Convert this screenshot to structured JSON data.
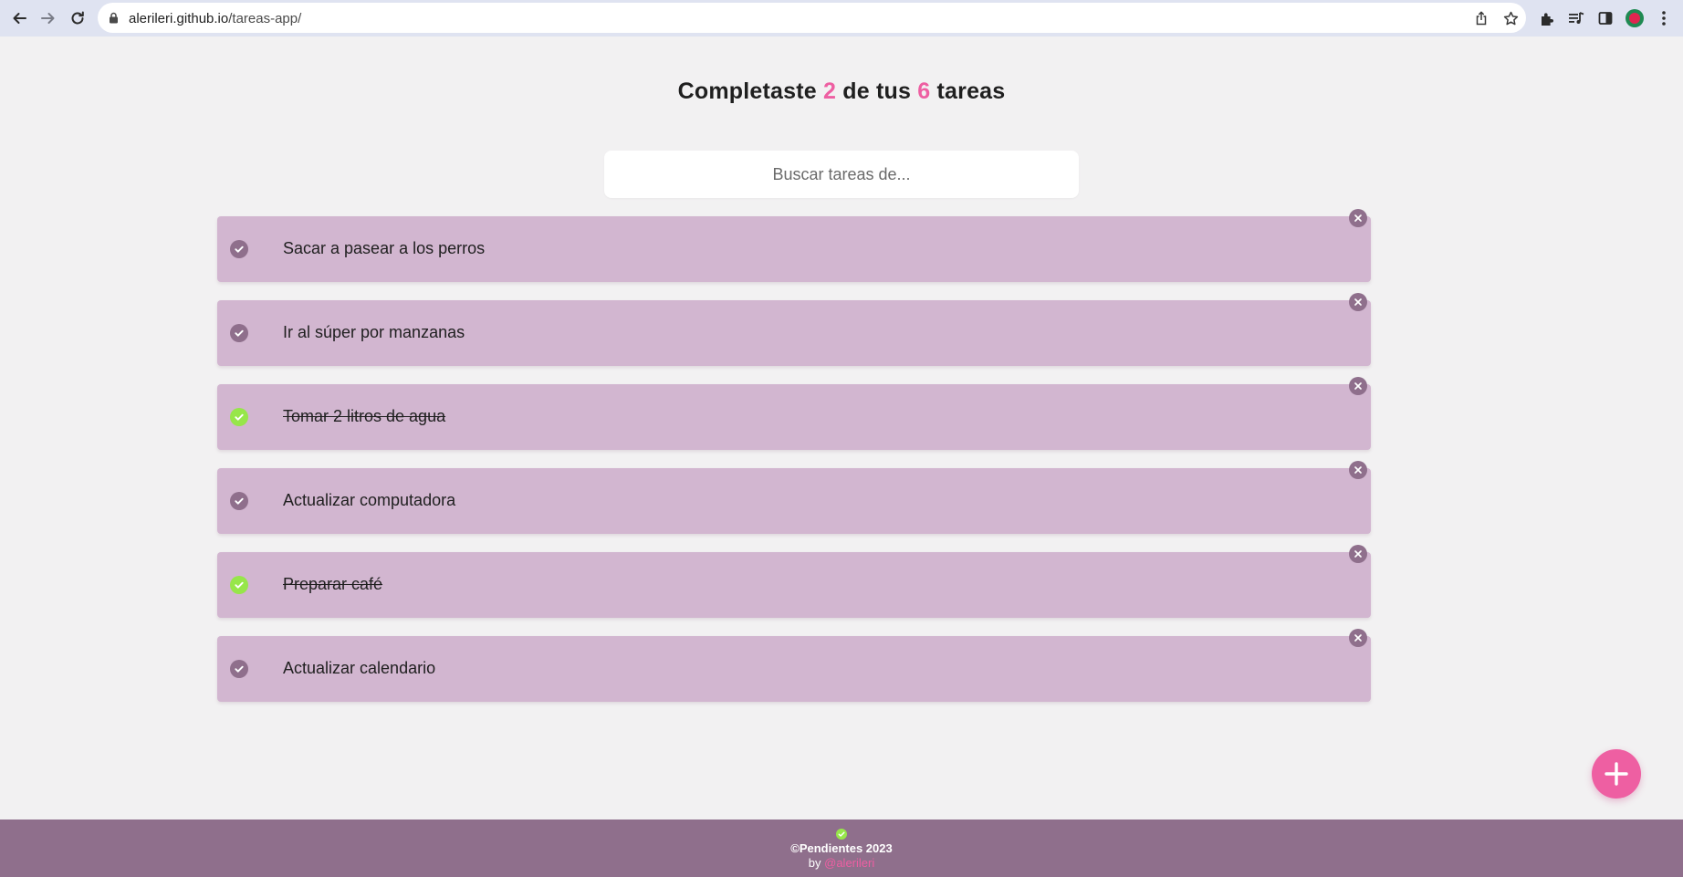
{
  "browser": {
    "url_host": "alerileri.github.io",
    "url_path": "/tareas-app/"
  },
  "header": {
    "title_part1": "Completaste",
    "completed_count": "2",
    "title_part2": "de tus",
    "total_count": "6",
    "title_part3": "tareas"
  },
  "search": {
    "placeholder": "Buscar tareas de...",
    "value": ""
  },
  "todos": [
    {
      "text": "Sacar a pasear a los perros",
      "completed": false
    },
    {
      "text": "Ir al súper por manzanas",
      "completed": false
    },
    {
      "text": "Tomar 2 litros de agua",
      "completed": true
    },
    {
      "text": "Actualizar computadora",
      "completed": false
    },
    {
      "text": "Preparar café",
      "completed": true
    },
    {
      "text": "Actualizar calendario",
      "completed": false
    }
  ],
  "footer": {
    "brand": "©Pendientes 2023",
    "by_label": "by",
    "author": "@alerileri"
  },
  "colors": {
    "page_background": "#f2f1f2",
    "item_background": "#d2b6d0",
    "muted_purple": "#8f6f8c",
    "accent_pink": "#ee5fa2",
    "complete_green": "#97e64a"
  },
  "icons": {
    "check": "check-circle-icon",
    "delete": "close-circle-icon",
    "add": "plus-icon"
  }
}
